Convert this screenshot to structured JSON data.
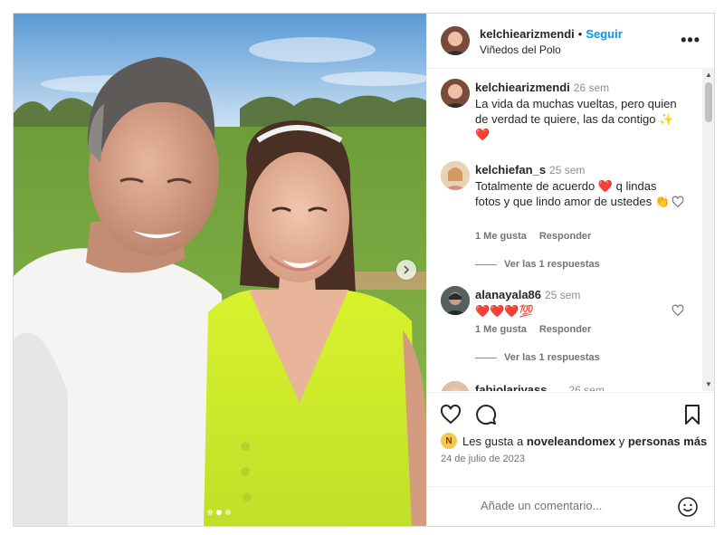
{
  "post": {
    "author": "kelchiearizmendi",
    "follow_label": "Seguir",
    "separator": "•",
    "location": "Viñedos del Polo",
    "more_label": "•••",
    "caption": {
      "user": "kelchiearizmendi",
      "time": "26 sem",
      "text": "La vida da muchas vueltas, pero quien de verdad te quiere, las da contigo ✨ ❤️"
    },
    "comments": [
      {
        "user": "kelchiefan_s",
        "time": "25 sem",
        "text": "Totalmente de acuerdo ❤️ q lindas fotos y que lindo amor de ustedes 👏",
        "likes_label": "1 Me gusta",
        "reply_label": "Responder",
        "view_replies": "Ver las 1 respuestas"
      },
      {
        "user": "alanayala86",
        "time": "25 sem",
        "text": "❤️❤️❤️💯",
        "likes_label": "1 Me gusta",
        "reply_label": "Responder",
        "view_replies": "Ver las 1 respuestas"
      },
      {
        "user": "fabiolarivass",
        "time": "26 sem"
      }
    ],
    "likes_text": {
      "prefix": "Les gusta a",
      "user": "noveleandomex",
      "middle": "y",
      "suffix": "personas más",
      "badge": "N"
    },
    "date": "24 de julio de 2023",
    "add_comment_placeholder": "Añade un comentario...",
    "colors": {
      "accent": "#0095f6",
      "heart_red": "#ed4956",
      "text": "#262626",
      "muted": "#737373"
    },
    "icons": [
      "heart-icon",
      "comment-icon",
      "bookmark-icon",
      "emoji-icon",
      "chevron-right-icon",
      "more-icon"
    ],
    "carousel": {
      "total": 3,
      "active_index": 1
    }
  }
}
